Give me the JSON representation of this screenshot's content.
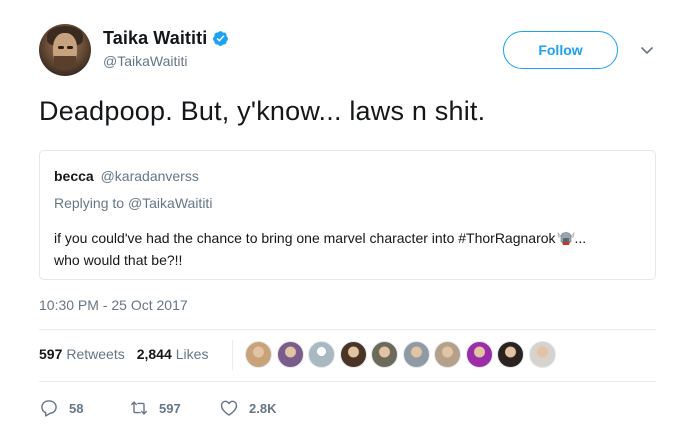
{
  "author": {
    "display_name": "Taika Waititi",
    "handle": "@TaikaWaititi",
    "verified": true
  },
  "follow_label": "Follow",
  "tweet": {
    "text": "Deadpoop. But, y'know... laws n shit.",
    "timestamp": "10:30 PM - 25 Oct 2017"
  },
  "quote": {
    "name": "becca",
    "handle": "@karadanverss",
    "replying_to_prefix": "Replying to ",
    "replying_to_handle": "@TaikaWaititi",
    "text_line1": "if you could've had the chance to bring one marvel character into #ThorRagnarok",
    "text_line1_suffix": "...",
    "text_line2": "who would that be?!!"
  },
  "stats": {
    "retweets_count": "597",
    "retweets_label": "Retweets",
    "likes_count": "2,844",
    "likes_label": "Likes"
  },
  "likers": [
    {
      "color": "#c9a27a",
      "icon": "person-avatar"
    },
    {
      "color": "#7a5c8a",
      "icon": "person-avatar"
    },
    {
      "color": "#aab8c2",
      "icon": "default-avatar"
    },
    {
      "color": "#4a3426",
      "icon": "person-avatar"
    },
    {
      "color": "#6d6a5a",
      "icon": "person-avatar"
    },
    {
      "color": "#8f9aa3",
      "icon": "person-avatar"
    },
    {
      "color": "#b5a08a",
      "icon": "person-avatar"
    },
    {
      "color": "#9b2ea8",
      "icon": "person-avatar"
    },
    {
      "color": "#2b2320",
      "icon": "person-avatar"
    },
    {
      "color": "#d7d2cc",
      "icon": "person-avatar"
    }
  ],
  "actions": {
    "replies": "58",
    "retweets": "597",
    "likes": "2.8K"
  },
  "colors": {
    "accent": "#1da1f2",
    "text_primary": "#14171a",
    "text_secondary": "#657786",
    "border": "#e1e8ed"
  }
}
